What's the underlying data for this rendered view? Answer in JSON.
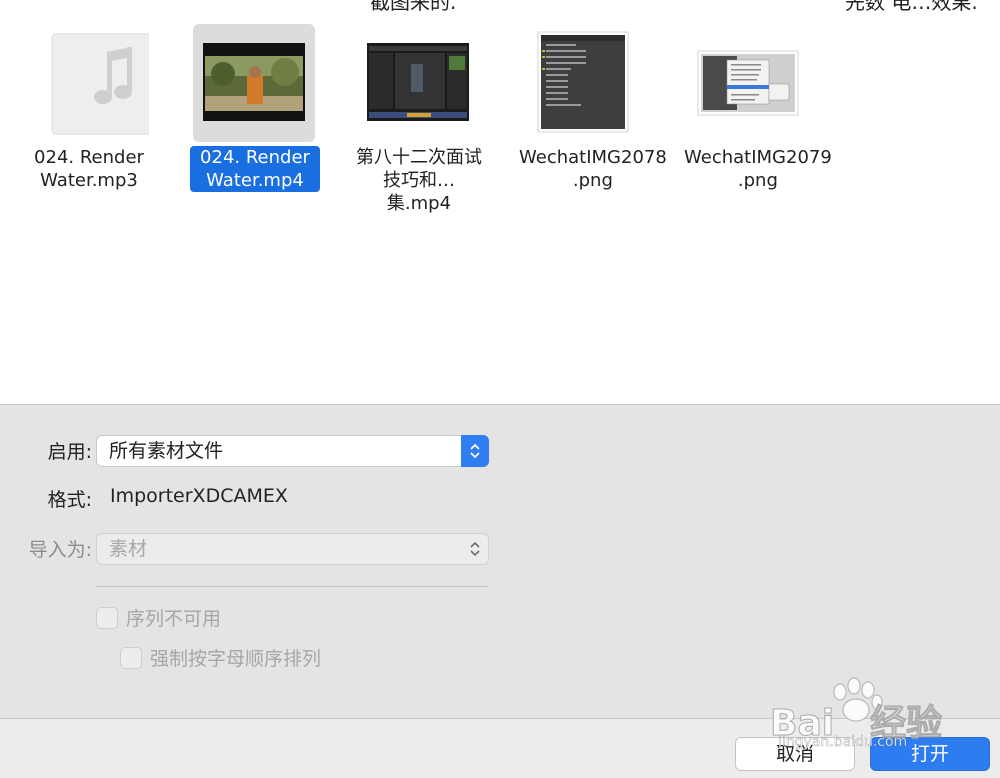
{
  "browser": {
    "top_clipped_left": "截图来的.",
    "top_clipped_right": "先数 电…效果.",
    "files": [
      {
        "line1": "024. Render",
        "line2": "Water.mp3",
        "kind": "audio-icon",
        "selected": false
      },
      {
        "line1": "024. Render",
        "line2": "Water.mp4",
        "kind": "video-thumbnail",
        "selected": true
      },
      {
        "line1": "第八十二次面试",
        "line2": "技巧和…集.mp4",
        "kind": "screen-recording-thumbnail",
        "selected": false
      },
      {
        "line1": "WechatIMG2078",
        "line2": ".png",
        "kind": "panel-screenshot-thumbnail",
        "selected": false
      },
      {
        "line1": "WechatIMG2079",
        "line2": ".png",
        "kind": "menu-screenshot-thumbnail",
        "selected": false
      }
    ]
  },
  "options": {
    "enable_label": "启用:",
    "enable_value": "所有素材文件",
    "format_label": "格式:",
    "format_value": "ImporterXDCAMEX",
    "import_as_label": "导入为:",
    "import_as_value": "素材",
    "sequence_unavailable": "序列不可用",
    "force_alphabetical": "强制按字母顺序排列"
  },
  "footer": {
    "cancel_label": "取消",
    "open_label": "打开"
  },
  "watermark": {
    "brand": "Bai",
    "brand_suffix": "经验",
    "url": "jingyan.baidu.com"
  },
  "colors": {
    "accent": "#2d7cf0",
    "selection": "#1a6fe0",
    "panel_bg": "#e4e4e4"
  }
}
